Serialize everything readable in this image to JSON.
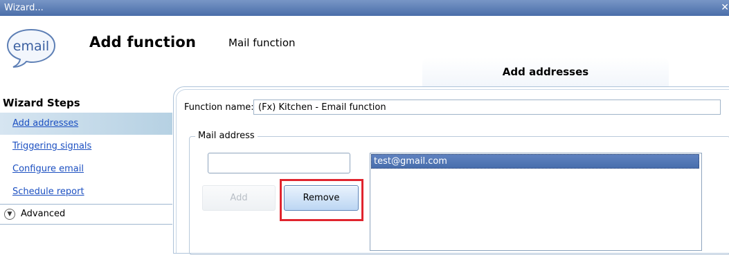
{
  "window": {
    "title": "Wizard..."
  },
  "header": {
    "logo_text": "email",
    "title": "Add function",
    "subtitle": "Mail function",
    "current_step_tab": "Add addresses"
  },
  "sidebar": {
    "heading": "Wizard Steps",
    "items": [
      {
        "label": "Add addresses",
        "active": true
      },
      {
        "label": "Triggering signals",
        "active": false
      },
      {
        "label": "Configure email",
        "active": false
      },
      {
        "label": "Schedule report",
        "active": false
      }
    ],
    "advanced_label": "Advanced"
  },
  "form": {
    "function_name_label": "Function name:",
    "function_name_value": "(Fx) Kitchen - Email function",
    "mail_group_label": "Mail address",
    "address_input_value": "",
    "add_button": "Add",
    "remove_button": "Remove",
    "addresses": [
      "test@gmail.com"
    ]
  },
  "colors": {
    "titlebar": "#5a7db5",
    "link": "#1b4fc1",
    "highlight": "#e0242e",
    "selected_row": "#4f74b4"
  }
}
